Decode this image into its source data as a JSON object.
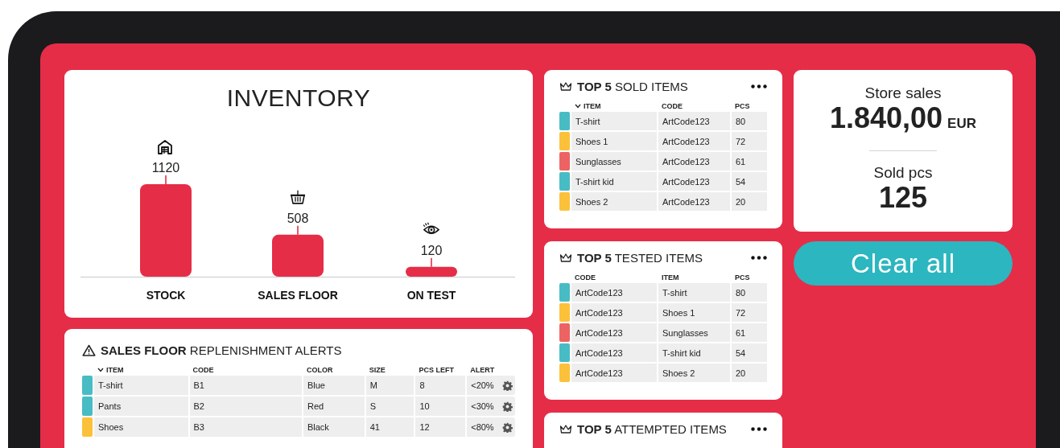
{
  "inventory": {
    "title": "INVENTORY",
    "chart_data": {
      "type": "bar",
      "categories": [
        "STOCK",
        "SALES FLOOR",
        "ON TEST"
      ],
      "values": [
        1120,
        508,
        120
      ],
      "data_labels": true
    }
  },
  "alerts": {
    "title": "**SALES FLOOR** REPLENISHMENT ALERTS",
    "columns": [
      {
        "label": "ITEM",
        "sorted": true
      },
      {
        "label": "CODE",
        "sorted": false
      },
      {
        "label": "COLOR",
        "sorted": false
      },
      {
        "label": "SIZE",
        "sorted": false
      },
      {
        "label": "PCS LEFT",
        "sorted": false
      },
      {
        "label": "ALERT",
        "sorted": false
      }
    ],
    "rows": [
      {
        "color": "#48bcc4",
        "cells": [
          "T-shirt",
          "B1",
          "Blue",
          "M",
          "8",
          "<20%"
        ]
      },
      {
        "color": "#48bcc4",
        "cells": [
          "Pants",
          "B2",
          "Red",
          "S",
          "10",
          "<30%"
        ]
      },
      {
        "color": "#fcc13a",
        "cells": [
          "Shoes",
          "B3",
          "Black",
          "41",
          "12",
          "<80%"
        ]
      }
    ]
  },
  "top_lists": [
    {
      "title": "**TOP 5** SOLD ITEMS",
      "columns": [
        {
          "label": "ITEM",
          "sorted": true
        },
        {
          "label": "CODE",
          "sorted": false
        },
        {
          "label": "PCS",
          "sorted": false
        }
      ],
      "rows": [
        {
          "color": "#48bcc4",
          "cells": [
            "T-shirt",
            "ArtCode123",
            "80"
          ]
        },
        {
          "color": "#fcc13a",
          "cells": [
            "Shoes 1",
            "ArtCode123",
            "72"
          ]
        },
        {
          "color": "#ed6363",
          "cells": [
            "Sunglasses",
            "ArtCode123",
            "61"
          ]
        },
        {
          "color": "#48bcc4",
          "cells": [
            "T-shirt kid",
            "ArtCode123",
            "54"
          ]
        },
        {
          "color": "#fcc13a",
          "cells": [
            "Shoes 2",
            "ArtCode123",
            "20"
          ]
        }
      ]
    },
    {
      "title": "**TOP 5** TESTED ITEMS",
      "columns": [
        {
          "label": "CODE",
          "sorted": false
        },
        {
          "label": "ITEM",
          "sorted": false
        },
        {
          "label": "PCS",
          "sorted": false
        }
      ],
      "rows": [
        {
          "color": "#48bcc4",
          "cells": [
            "ArtCode123",
            "T-shirt",
            "80"
          ]
        },
        {
          "color": "#fcc13a",
          "cells": [
            "ArtCode123",
            "Shoes 1",
            "72"
          ]
        },
        {
          "color": "#ed6363",
          "cells": [
            "ArtCode123",
            "Sunglasses",
            "61"
          ]
        },
        {
          "color": "#48bcc4",
          "cells": [
            "ArtCode123",
            "T-shirt kid",
            "54"
          ]
        },
        {
          "color": "#fcc13a",
          "cells": [
            "ArtCode123",
            "Shoes 2",
            "20"
          ]
        }
      ]
    },
    {
      "title": "**TOP 5** ATTEMPTED ITEMS"
    }
  ],
  "stats": [
    {
      "label": "Store sales",
      "value": "1.840,00",
      "unit": "EUR"
    },
    {
      "label": "Sold pcs",
      "value": "125"
    }
  ],
  "clear_button": "Clear all"
}
